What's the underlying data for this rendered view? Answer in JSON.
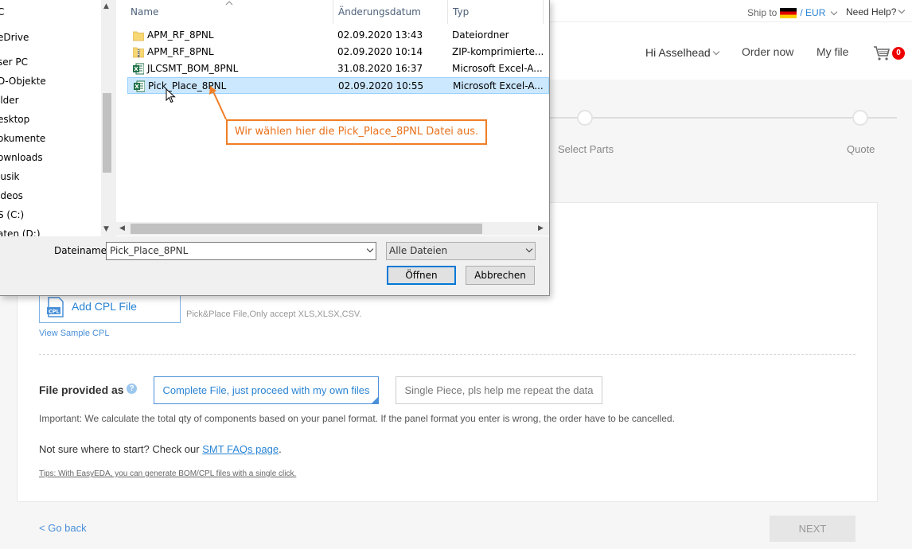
{
  "topstrip": {
    "ship_label": "Ship to",
    "currency": "/ EUR",
    "help": "Need Help?"
  },
  "nav": {
    "greeting": "Hi Asselhead",
    "order_now": "Order now",
    "my_file": "My file",
    "cart_count": "0"
  },
  "steps": [
    "Select Parts",
    "Quote"
  ],
  "upload": {
    "add_cpl": "Add CPL File",
    "cpl_hint": "Pick&Place File,Only accept XLS,XLSX,CSV.",
    "view_sample": "View Sample CPL"
  },
  "provided": {
    "label": "File provided as",
    "option_complete": "Complete File, just proceed with my own files",
    "option_single": "Single Piece, pls help me repeat the data",
    "important": "Important: We calculate the total qty of components based on your panel format. If the panel format you enter is wrong, the order have to be cancelled.",
    "not_sure": "Not sure where to start? Check our",
    "faq_link": "SMT FAQs page",
    "period": ".",
    "tips": "Tips: With EasyEDA, you can generate BOM/CPL files with a single click."
  },
  "footer": {
    "go_back": "< Go back",
    "next": "NEXT"
  },
  "dialog": {
    "tree_items": [
      "C",
      "eDrive",
      "ser PC",
      "D-Objekte",
      "ilder",
      "esktop",
      "okumente",
      "ownloads",
      "lusik",
      "ideos",
      "S (C:)",
      "aten (D:)"
    ],
    "columns": {
      "name": "Name",
      "date": "Änderungsdatum",
      "type": "Typ"
    },
    "files": [
      {
        "name": "APM_RF_8PNL",
        "date": "02.09.2020 13:43",
        "type": "Dateiordner",
        "icon": "folder-icon",
        "selected": false
      },
      {
        "name": "APM_RF_8PNL",
        "date": "02.09.2020 10:14",
        "type": "ZIP-komprimierte...",
        "icon": "zip-icon",
        "selected": false
      },
      {
        "name": "JLCSMT_BOM_8PNL",
        "date": "31.08.2020 16:37",
        "type": "Microsoft Excel-A...",
        "icon": "excel-icon",
        "selected": false
      },
      {
        "name": "Pick_Place_8PNL",
        "date": "02.09.2020 10:55",
        "type": "Microsoft Excel-A...",
        "icon": "excel-icon",
        "selected": true
      }
    ],
    "filename_label": "Dateiname:",
    "filename_value": "Pick_Place_8PNL",
    "filter_value": "Alle Dateien",
    "open_button": "Öffnen",
    "cancel_button": "Abbrechen"
  },
  "annotation": {
    "text": "Wir wählen hier die Pick_Place_8PNL Datei aus.",
    "color": "#f07e26"
  },
  "colors": {
    "accent": "#2a84d4",
    "selection": "#cce8ff",
    "badge": "#ee0000"
  }
}
